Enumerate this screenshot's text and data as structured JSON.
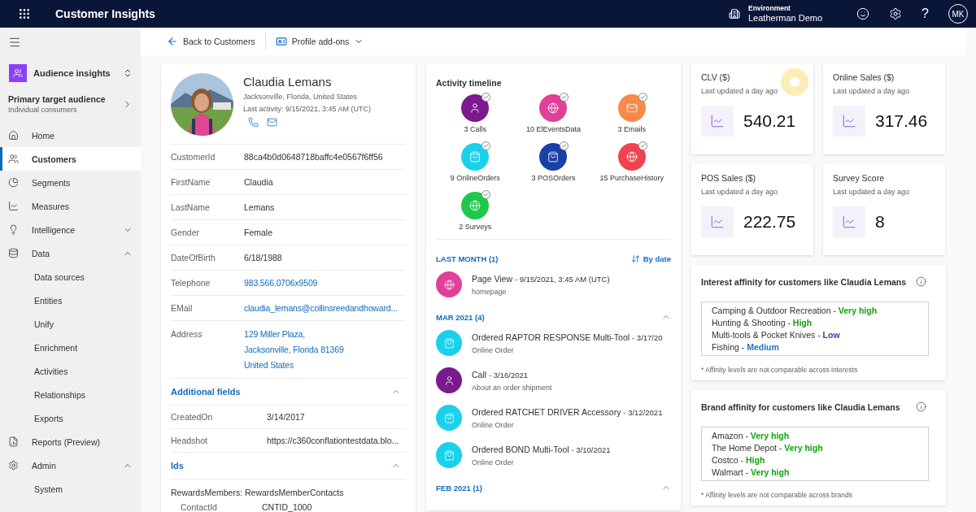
{
  "top_bar": {
    "app_title": "Customer Insights",
    "environment_label": "Environment",
    "environment_name": "Leatherman Demo",
    "help": "?",
    "user_initials": "MK"
  },
  "sidebar": {
    "switcher": {
      "title": "Audience insights"
    },
    "audience": {
      "title": "Primary target audience",
      "subtitle": "Individual consumers"
    },
    "items": [
      {
        "label": "Home",
        "kind": "home",
        "selected": false
      },
      {
        "label": "Customers",
        "kind": "people",
        "selected": true
      },
      {
        "label": "Segments",
        "kind": "pie",
        "selected": false
      },
      {
        "label": "Measures",
        "kind": "chart",
        "selected": false
      },
      {
        "label": "Intelligence",
        "kind": "bulb",
        "selected": false,
        "expanded": false
      },
      {
        "label": "Data",
        "kind": "data",
        "selected": false,
        "expanded": true,
        "children": [
          {
            "label": "Data sources",
            "selected": false
          },
          {
            "label": "Entities",
            "selected": false
          },
          {
            "label": "Unify",
            "selected": false
          },
          {
            "label": "Enrichment",
            "selected": false
          },
          {
            "label": "Activities",
            "selected": false
          },
          {
            "label": "Relationships",
            "selected": false
          },
          {
            "label": "Exports",
            "selected": false
          }
        ]
      },
      {
        "label": "Reports (Preview)",
        "kind": "report",
        "selected": false
      },
      {
        "label": "Admin",
        "kind": "gear",
        "selected": false,
        "expanded": true,
        "children": [
          {
            "label": "System",
            "selected": false
          }
        ]
      }
    ]
  },
  "command_bar": {
    "back": "Back to Customers",
    "addons": "Profile add-ons"
  },
  "profile": {
    "name": "Claudia Lemans",
    "location": "Jacksonville, Florida, United States",
    "last_activity": "Last activity: 9/15/2021, 3:45 AM (UTC)",
    "fields": [
      {
        "label": "CustomerId",
        "kind": "text",
        "value": [
          "88ca4b0d0648718baffc4e0567f6ff56"
        ]
      },
      {
        "label": "FirstName",
        "kind": "text",
        "value": [
          "Claudia"
        ]
      },
      {
        "label": "LastName",
        "kind": "text",
        "value": [
          "Lemans"
        ]
      },
      {
        "label": "Gender",
        "kind": "text",
        "value": [
          "Female"
        ]
      },
      {
        "label": "DateOfBirth",
        "kind": "text",
        "value": [
          "6/18/1988"
        ]
      },
      {
        "label": "Telephone",
        "kind": "link",
        "value": [
          "983.566.0706x9509"
        ]
      },
      {
        "label": "EMail",
        "kind": "link",
        "value": [
          "claudia_lemans@collinsreedandhoward..."
        ]
      },
      {
        "label": "Address",
        "kind": "link",
        "value": [
          "129 Miller Plaza,",
          "Jacksonville, Florida 81369",
          "United States"
        ]
      }
    ],
    "additional": {
      "title": "Additional fields",
      "expanded": true,
      "fields": [
        {
          "label": "CreatedOn",
          "value": "3/14/2017"
        },
        {
          "label": "Headshot",
          "value": "https://c360conflationtestdata.blo..."
        }
      ]
    },
    "ids": {
      "title": "Ids",
      "expanded": true,
      "group": "RewardsMembers: RewardsMemberContacts",
      "fields": [
        {
          "label": "ContactId",
          "value": "CNTID_1000"
        }
      ]
    }
  },
  "timeline": {
    "title": "Activity timeline",
    "sort": "By date",
    "types": [
      {
        "label": "3 Calls",
        "kind": "person",
        "color": "#7a1a8c"
      },
      {
        "label": "10 ElEventsData",
        "kind": "globe",
        "color": "#e0409a"
      },
      {
        "label": "3 Emails",
        "kind": "mail",
        "color": "#f7894a"
      },
      {
        "label": "9 OnlineOrders",
        "kind": "bag",
        "color": "#1ad1ec"
      },
      {
        "label": "3 POSOrders",
        "kind": "bag",
        "color": "#1b3fa8"
      },
      {
        "label": "15 PurchaseHistory",
        "kind": "globe",
        "color": "#f0434f"
      },
      {
        "label": "2 Surveys",
        "kind": "globe",
        "color": "#1ec84a"
      }
    ],
    "groups": [
      {
        "label": "LAST MONTH (1)",
        "kind": "sorted",
        "entries": [
          {
            "title": "Page View",
            "date": "- 9/15/2021, 3:45 AM (UTC)",
            "subtitle": "homepage",
            "kind": "globe",
            "color": "#e0409a"
          }
        ]
      },
      {
        "label": "MAR 2021 (4)",
        "kind": "collapsible",
        "expanded": true,
        "entries": [
          {
            "title": "Ordered RAPTOR RESPONSE Multi-Tool",
            "date": "- 3/17/20",
            "subtitle": "Online Order",
            "kind": "bag",
            "color": "#1ad1ec"
          },
          {
            "title": "Call",
            "date": "- 3/16/2021",
            "subtitle": "About an order shipment",
            "kind": "person",
            "color": "#7a1a8c"
          },
          {
            "title": "Ordered RATCHET DRIVER Accessory",
            "date": "- 3/12/2021",
            "subtitle": "Online Order",
            "kind": "bag",
            "color": "#1ad1ec"
          },
          {
            "title": "Ordered BOND Multi-Tool",
            "date": "- 3/10/2021",
            "subtitle": "Online Order",
            "kind": "bag",
            "color": "#1ad1ec"
          }
        ]
      },
      {
        "label": "FEB 2021 (1)",
        "kind": "collapsible",
        "expanded": true
      }
    ]
  },
  "kpis": [
    {
      "title": "CLV ($)",
      "updated": "Last updated a day ago",
      "value": "540.21"
    },
    {
      "title": "Online Sales ($)",
      "updated": "Last updated a day ago",
      "value": "317.46"
    },
    {
      "title": "POS Sales ($)",
      "updated": "Last updated a day ago",
      "value": "222.75"
    },
    {
      "title": "Survey Score",
      "updated": "Last updated a day ago",
      "value": "8"
    }
  ],
  "affinities": [
    {
      "title": "Interest affinity for customers like Claudia Lemans",
      "note": "* Affinity levels are not comparable across interests",
      "items": [
        {
          "name": "Camping & Outdoor Recreation -",
          "level": "Very high",
          "color": "#13a10e"
        },
        {
          "name": "Hunting & Shooting -",
          "level": "High",
          "color": "#13a10e"
        },
        {
          "name": "Multi-tools & Pocket Knives -",
          "level": "Low",
          "color": "#3c3ca8"
        },
        {
          "name": "Fishing -",
          "level": "Medium",
          "color": "#2e73b8"
        }
      ]
    },
    {
      "title": "Brand affinity for customers like Claudia Lemans",
      "note": "* Affinity levels are not comparable across brands",
      "items": [
        {
          "name": "Amazon -",
          "level": "Very high",
          "color": "#13a10e"
        },
        {
          "name": "The Home Depot -",
          "level": "Very high",
          "color": "#13a10e"
        },
        {
          "name": "Costco -",
          "level": "High",
          "color": "#13a10e"
        },
        {
          "name": "Walmart -",
          "level": "Very high",
          "color": "#13a10e"
        }
      ]
    }
  ]
}
